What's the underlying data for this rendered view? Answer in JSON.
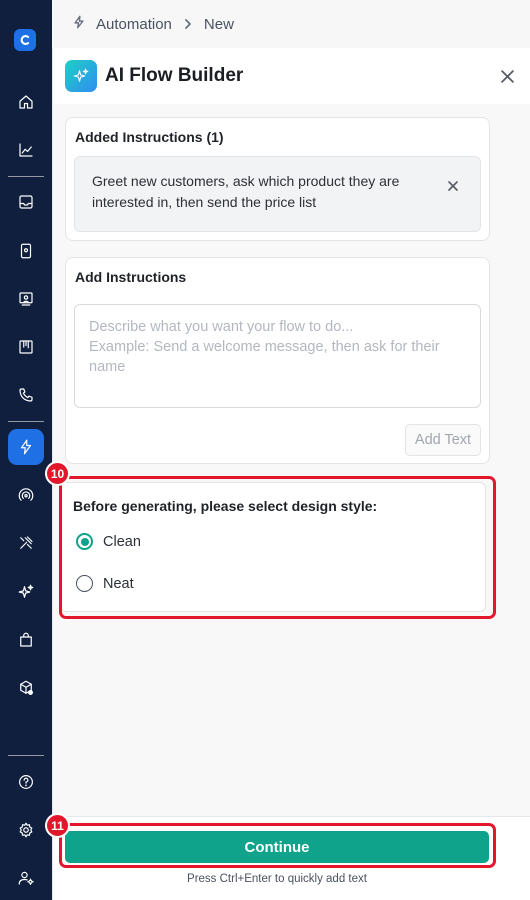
{
  "breadcrumb": {
    "section": "Automation",
    "page": "New"
  },
  "panel": {
    "title": "AI Flow Builder"
  },
  "added_instructions": {
    "title": "Added Instructions (1)",
    "items": [
      "Greet new customers, ask which product they are interested in, then send the price list"
    ]
  },
  "add_instructions": {
    "title": "Add Instructions",
    "placeholder": "Describe what you want your flow to do...\nExample: Send a welcome message, then ask for their name",
    "button": "Add Text"
  },
  "design_style": {
    "title": "Before generating, please select design style:",
    "options": [
      {
        "label": "Clean",
        "selected": true
      },
      {
        "label": "Neat",
        "selected": false
      }
    ]
  },
  "footer": {
    "continue": "Continue",
    "hint": "Press Ctrl+Enter to quickly add text"
  },
  "annotations": {
    "style_step": "10",
    "continue_step": "11"
  },
  "sidebar": {
    "icons": [
      "logo-icon",
      "home-icon",
      "analytics-icon",
      "inbox-icon",
      "contacts-icon",
      "broadcast-icon",
      "board-icon",
      "calls-icon",
      "automation-icon",
      "signal-icon",
      "tools-icon",
      "ai-sparkle-icon",
      "store-icon",
      "package-icon",
      "help-icon",
      "settings-icon",
      "user-settings-icon"
    ],
    "active": "automation-icon"
  },
  "colors": {
    "accent": "#0fa38b",
    "highlight": "#e2172b",
    "sidebar": "#0f1f3d",
    "active": "#1f6fe5"
  }
}
